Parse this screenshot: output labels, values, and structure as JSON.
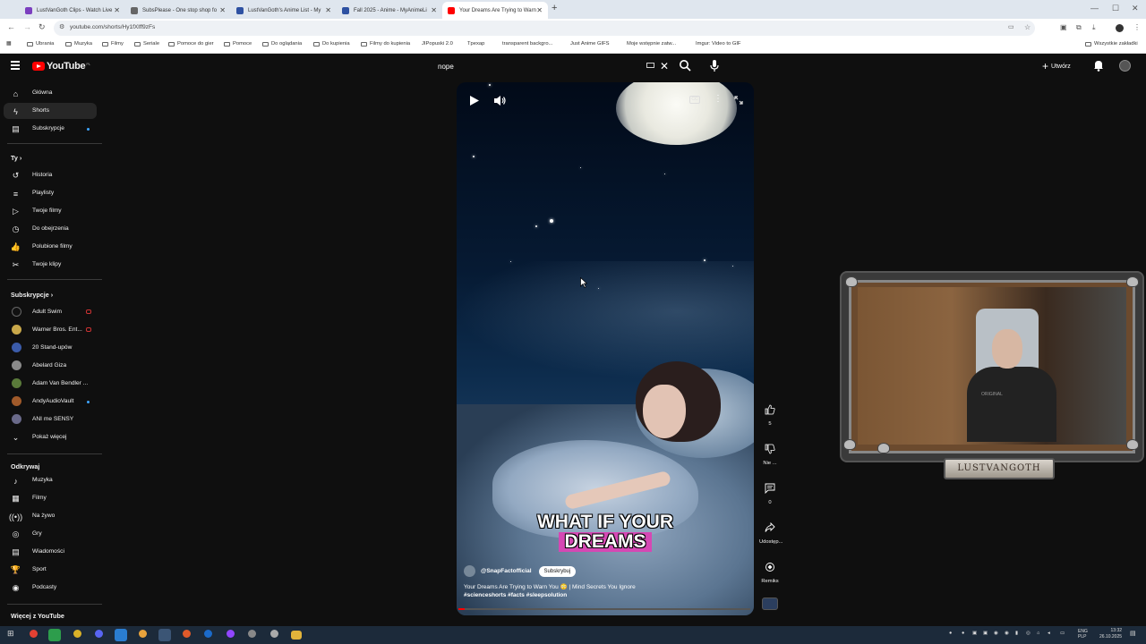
{
  "browser": {
    "tabs": [
      {
        "title": "LustVanGoth Clips - Watch Live",
        "color": "#7b3fbf"
      },
      {
        "title": "SubsPlease - One stop shop fo",
        "color": "#666666"
      },
      {
        "title": "LustVanGoth's Anime List - My",
        "color": "#2e51a2"
      },
      {
        "title": "Fall 2025 - Anime - MyAnimeLi",
        "color": "#2e51a2"
      },
      {
        "title": "Your Dreams Are Trying to Warn",
        "color": "#ff0000"
      }
    ],
    "url": "youtube.com/shorts/Hy1fXlff9zFs",
    "bookmarks": [
      "Ubrania",
      "Muzyka",
      "Filmy",
      "Seriale",
      "Pomoce do gier",
      "Pomoce",
      "Do oglądania",
      "Do kupienia",
      "Filmy do kupienia",
      "JIPopuski 2.0",
      "Tpexap",
      "transparent backgro...",
      "Just Anime GIFS",
      "Moje wstępnie zatw...",
      "Imgur: Video to GIF"
    ],
    "all_bookmarks": "Wszystkie zakładki"
  },
  "header": {
    "logo": "YouTube",
    "country": "PL",
    "search_value": "nope",
    "create_label": "Utwórz"
  },
  "sidebar": {
    "main": [
      {
        "label": "Główna",
        "icon": "home-icon"
      },
      {
        "label": "Shorts",
        "icon": "shorts-icon"
      },
      {
        "label": "Subskrypcje",
        "icon": "subscriptions-icon"
      }
    ],
    "you_header": "Ty",
    "you": [
      {
        "label": "Historia",
        "icon": "history-icon"
      },
      {
        "label": "Playlisty",
        "icon": "playlist-icon"
      },
      {
        "label": "Twoje filmy",
        "icon": "video-icon"
      },
      {
        "label": "Do obejrzenia",
        "icon": "watch-later-icon"
      },
      {
        "label": "Polubione filmy",
        "icon": "like-icon"
      },
      {
        "label": "Twoje klipy",
        "icon": "scissors-icon"
      }
    ],
    "subs_header": "Subskrypcje",
    "subs": [
      {
        "label": "Adult Swim",
        "color": "#111111"
      },
      {
        "label": "Warner Bros. Ent...",
        "color": "#c9a84a"
      },
      {
        "label": "20 Stand-upów",
        "color": "#3b5ba9"
      },
      {
        "label": "Abelard Giza",
        "color": "#8a8a8a"
      },
      {
        "label": "Adam Van Bendler ...",
        "color": "#5a7a3a"
      },
      {
        "label": "AndyAudioVault",
        "color": "#a05a2a"
      },
      {
        "label": "ANI me SENSY",
        "color": "#6a6a8a"
      }
    ],
    "show_more": "Pokaż więcej",
    "explore_header": "Odkrywaj",
    "explore": [
      {
        "label": "Muzyka",
        "icon": "music-icon"
      },
      {
        "label": "Filmy",
        "icon": "film-icon"
      },
      {
        "label": "Na żywo",
        "icon": "live-icon"
      },
      {
        "label": "Gry",
        "icon": "gamepad-icon"
      },
      {
        "label": "Wiadomości",
        "icon": "news-icon"
      },
      {
        "label": "Sport",
        "icon": "trophy-icon"
      },
      {
        "label": "Podcasty",
        "icon": "podcast-icon"
      }
    ],
    "more_header": "Więcej z YouTube"
  },
  "short": {
    "caption_line1": "WHAT IF YOUR",
    "caption_line2": "DREAMS",
    "channel": "@SnapFactofficial",
    "subscribe_label": "Subskrybuj",
    "title": "Your Dreams Are Trying to Warn You 😳 | Mind Secrets You Ignore",
    "hashtags": "#scienceshorts #facts #sleepsolution",
    "progress_fraction": 0.02,
    "cc_label": "CC"
  },
  "actions": {
    "likes": "5",
    "dislike_label": "Nie ...",
    "comments": "0",
    "share_label": "Udostęp...",
    "remix_label": "Remiks"
  },
  "webcam": {
    "nameplate": "LUSTVANGOTH",
    "shirt_text": "ORIGINAL"
  },
  "taskbar": {
    "lang": "ENG",
    "lang2": "PLP",
    "time": "13:32",
    "date": "26.10.2025"
  }
}
